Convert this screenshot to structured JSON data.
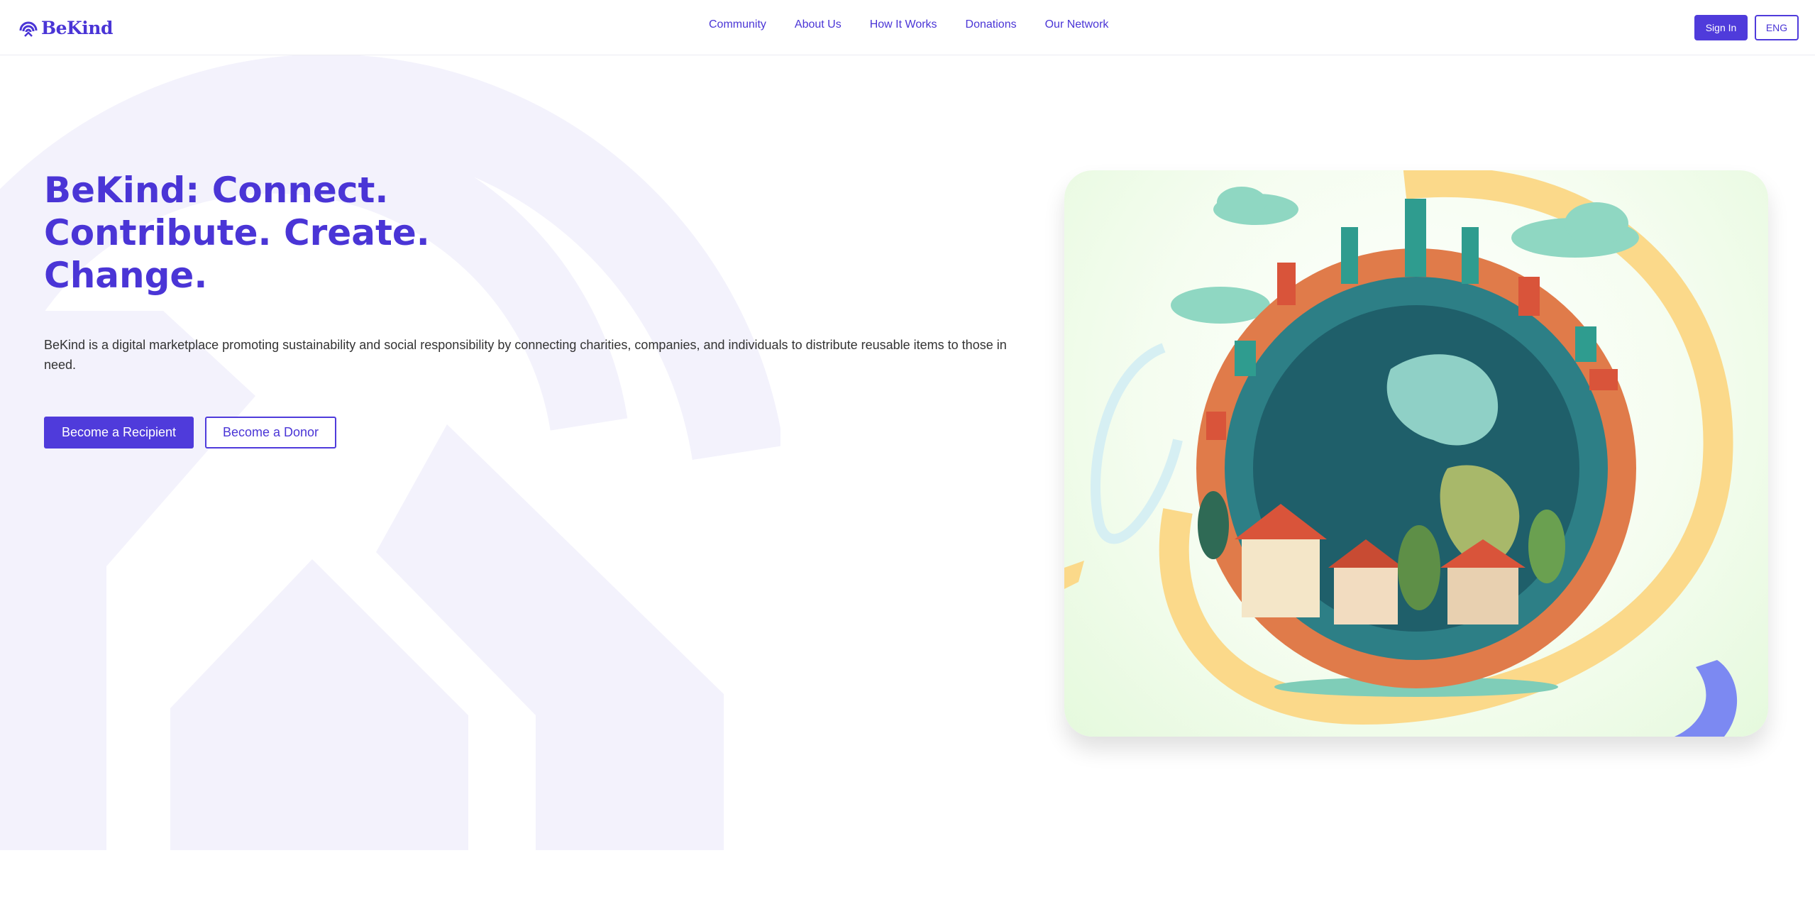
{
  "brand": {
    "name": "BeKind",
    "color": "#4a35d6"
  },
  "nav": {
    "items": [
      {
        "label": "Community"
      },
      {
        "label": "About Us"
      },
      {
        "label": "How It Works"
      },
      {
        "label": "Donations"
      },
      {
        "label": "Our Network"
      }
    ]
  },
  "header": {
    "sign_in_label": "Sign In",
    "language_label": "ENG"
  },
  "hero": {
    "headline_lines": [
      "BeKind: Connect.",
      "Contribute. Create.",
      "Change."
    ],
    "description": "BeKind is a digital marketplace promoting sustainability and social responsibility by connecting charities, companies, and individuals to distribute reusable items to those in need.",
    "primary_cta": "Become a Recipient",
    "secondary_cta": "Become a Donor",
    "illustration_icon": "globe-city-illustration"
  },
  "colors": {
    "accent": "#4f3bdb",
    "background_shape": "#f3f2fc"
  }
}
